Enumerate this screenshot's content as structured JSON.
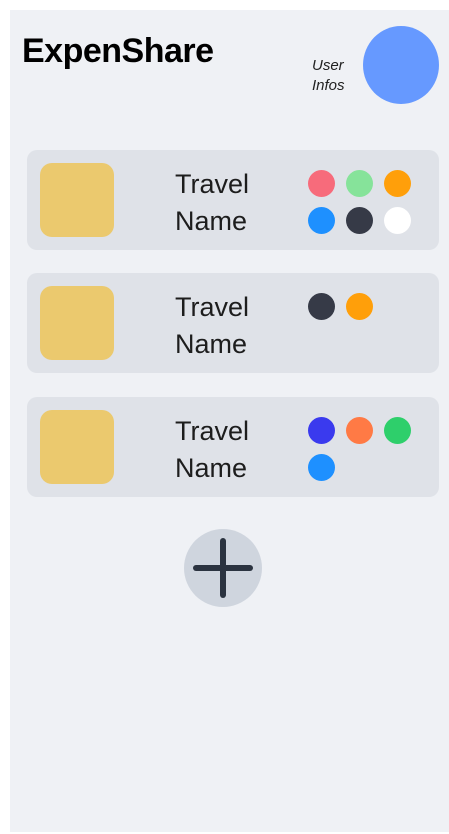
{
  "app": {
    "title": "ExpenShare"
  },
  "user": {
    "label_line1": "User",
    "label_line2": "Infos",
    "avatar_color": "#6699ff"
  },
  "travels": [
    {
      "name_line1": "Travel",
      "name_line2": "Name",
      "thumbnail_color": "#ebc96e",
      "participants": [
        "#f76b7b",
        "#86e39a",
        "#ff9f0a",
        "#1e90ff",
        "#363a47",
        "#ffffff"
      ]
    },
    {
      "name_line1": "Travel",
      "name_line2": "Name",
      "thumbnail_color": "#ebc96e",
      "participants": [
        "#363a47",
        "#ff9f0a"
      ]
    },
    {
      "name_line1": "Travel",
      "name_line2": "Name",
      "thumbnail_color": "#ebc96e",
      "participants": [
        "#3a3aee",
        "#ff7a45",
        "#2ecf6b",
        "#1e90ff"
      ]
    }
  ],
  "add_travel": {
    "icon": "plus-icon"
  },
  "colors": {
    "background": "#eff1f5",
    "card": "#dfe2e8",
    "add_button": "#cfd5de"
  }
}
